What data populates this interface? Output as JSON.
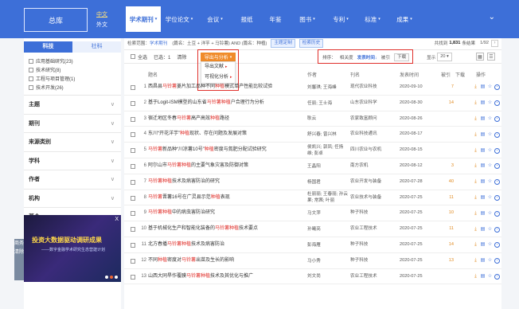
{
  "topnav": {
    "library_button": "总库",
    "lang_tabs": [
      "中文",
      "外文"
    ],
    "tabs": [
      {
        "label": "学术期刊",
        "dropdown": true
      },
      {
        "label": "学位论文",
        "dropdown": true
      },
      {
        "label": "会议",
        "dropdown": true
      },
      {
        "label": "报纸",
        "dropdown": false
      },
      {
        "label": "年鉴",
        "dropdown": false
      },
      {
        "label": "图书",
        "dropdown": true
      },
      {
        "label": "专利",
        "dropdown": true
      },
      {
        "label": "标准",
        "dropdown": true
      },
      {
        "label": "成果",
        "dropdown": true
      }
    ],
    "expand_icon": "chevron-down-icon",
    "brand_color": "#3d6fd8"
  },
  "sidebar": {
    "tabs": [
      "科技",
      "社科"
    ],
    "checklist": [
      "应用基础研究(23)",
      "技术研究(8)",
      "工程与项目管理(1)",
      "技术开发(26)"
    ],
    "sections": [
      "主题",
      "期刊",
      "来源类别",
      "学科",
      "作者",
      "机构",
      "基金"
    ],
    "ad": {
      "title": "投资大数据驱动调研成果",
      "subtitle": "——数字金融学术研究生态营建计划",
      "close": "X"
    },
    "side_edge": [
      "商务",
      "清除"
    ]
  },
  "breadcrumb": {
    "prefix": "检索范围：",
    "scope": "学术期刊",
    "query": "(篇名：土豆 + 洋芋 + 马铃薯) AND (篇名：种植)",
    "buttons": [
      "主题定制",
      "检索历史"
    ],
    "total_prefix": "共找到",
    "total": "1,831",
    "total_suffix": "条结果",
    "page": "1/92",
    "next_icon": "chevron-right-icon"
  },
  "toolbar": {
    "select_all": "全选",
    "selected": "已选：1",
    "clear": "清除",
    "export_button": "导出与分析",
    "export_menu": [
      "导出文献",
      "可视化分析"
    ],
    "sort_label": "排序：",
    "sort_options": [
      "相关度",
      "发表时间↓",
      "被引",
      "下载"
    ],
    "sort_active_index": 1,
    "show_label": "显示",
    "show_value": "20",
    "highlight_color": "#e0302b",
    "export_color": "#f08b2a"
  },
  "table": {
    "headers": {
      "title": "题名",
      "author": "作者",
      "source": "刊名",
      "date": "发表时间",
      "cite": "被引",
      "down": "下载",
      "ops": "操作"
    },
    "rows": [
      {
        "num": "1",
        "title": [
          {
            "t": "西昌县"
          },
          {
            "t": "马铃薯",
            "k": true
          },
          {
            "t": "菱片加工品种不同"
          },
          {
            "t": "种植",
            "k": true
          },
          {
            "t": "模式单产性能比较试验"
          }
        ],
        "author": "刘馨琪; 王海峰",
        "source": "现代农业科技",
        "date": "2020-09-10",
        "cite": "7",
        "down": ""
      },
      {
        "num": "2",
        "title": [
          {
            "t": "基于Logit-ISM模型的山东省"
          },
          {
            "t": "马铃薯",
            "k": true
          },
          {
            "t": "种植",
            "k": true
          },
          {
            "t": "户合理行为分析"
          }
        ],
        "author": "任丽; 王士海",
        "source": "山东农业科学",
        "date": "2020-08-30",
        "cite": "14",
        "down": ""
      },
      {
        "num": "3",
        "title": [
          {
            "t": "宿迁地区冬春"
          },
          {
            "t": "马铃薯",
            "k": true
          },
          {
            "t": "高产高效"
          },
          {
            "t": "种植",
            "k": true
          },
          {
            "t": "路径"
          }
        ],
        "author": "耿云",
        "source": "农家致富顾问",
        "date": "2020-08-26",
        "cite": "",
        "down": ""
      },
      {
        "num": "4",
        "title": [
          {
            "t": "东川“开花洋芋”"
          },
          {
            "t": "种植",
            "k": true
          },
          {
            "t": "现状、存在问题及发展对策"
          }
        ],
        "author": "舒兴春; 曾兴林",
        "source": "农业科技通讯",
        "date": "2020-08-17",
        "cite": "",
        "down": ""
      },
      {
        "num": "5",
        "title": [
          {
            "t": "马铃薯",
            "k": true
          },
          {
            "t": "新品种“川凉薯10号”"
          },
          {
            "t": "种植",
            "k": true
          },
          {
            "t": "密度与氮肥分配试验研究"
          }
        ],
        "author": "侯凯兴; 郭凤; 任扬维; 彭卓",
        "source": "四川农业与农机",
        "date": "2020-08-15",
        "cite": "",
        "down": ""
      },
      {
        "num": "6",
        "title": [
          {
            "t": "阿尔山市"
          },
          {
            "t": "马铃薯",
            "k": true
          },
          {
            "t": "种植",
            "k": true
          },
          {
            "t": "的主要气象灾害及防御对策"
          }
        ],
        "author": "王晶阳",
        "source": "南方农机",
        "date": "2020-08-12",
        "cite": "3",
        "down": ""
      },
      {
        "num": "7",
        "title": [
          {
            "t": "马铃薯",
            "k": true
          },
          {
            "t": "种植",
            "k": true
          },
          {
            "t": "技术及病害防治的研究"
          }
        ],
        "author": "杨国君",
        "source": "农业开发与装备",
        "date": "2020-07-28",
        "cite": "40",
        "down": ""
      },
      {
        "num": "8",
        "title": [
          {
            "t": "马铃薯",
            "k": true
          },
          {
            "t": "晋薯16号在广灵县示范"
          },
          {
            "t": "种植",
            "k": true
          },
          {
            "t": "表现"
          }
        ],
        "author": "杜丽丽; 王春丽; 孙云果; 常茜; 叶丽",
        "source": "农业技术与装备",
        "date": "2020-07-25",
        "cite": "11",
        "down": ""
      },
      {
        "num": "9",
        "title": [
          {
            "t": "马铃薯",
            "k": true
          },
          {
            "t": "种植",
            "k": true
          },
          {
            "t": "中的病虫害防治研究"
          }
        ],
        "author": "马文萍",
        "source": "种子科技",
        "date": "2020-07-25",
        "cite": "10",
        "down": ""
      },
      {
        "num": "10",
        "title": [
          {
            "t": "基于机械化生产和智能化装备的"
          },
          {
            "t": "马铃薯",
            "k": true
          },
          {
            "t": "种植",
            "k": true
          },
          {
            "t": "技术要点"
          }
        ],
        "author": "孙曦亮",
        "source": "农业工程技术",
        "date": "2020-07-25",
        "cite": "11",
        "down": ""
      },
      {
        "num": "11",
        "title": [
          {
            "t": "北方春播"
          },
          {
            "t": "马铃薯",
            "k": true
          },
          {
            "t": "种植",
            "k": true
          },
          {
            "t": "技术及病害防治"
          }
        ],
        "author": "彭海雁",
        "source": "种子科技",
        "date": "2020-07-25",
        "cite": "14",
        "down": ""
      },
      {
        "num": "12",
        "title": [
          {
            "t": "不同"
          },
          {
            "t": "种植",
            "k": true
          },
          {
            "t": "密度对"
          },
          {
            "t": "马铃薯",
            "k": true
          },
          {
            "t": "出苗及生长的影响"
          }
        ],
        "author": "马小秀",
        "source": "种子科技",
        "date": "2020-07-25",
        "cite": "13",
        "down": ""
      },
      {
        "num": "13",
        "title": [
          {
            "t": "山西大同旱作覆膜"
          },
          {
            "t": "马铃薯",
            "k": true
          },
          {
            "t": "种植",
            "k": true
          },
          {
            "t": "技术及其优化与推广"
          }
        ],
        "author": "刘文尚",
        "source": "农业工程技术",
        "date": "2020-07-25",
        "cite": "",
        "down": ""
      }
    ],
    "op_icons": [
      "download-icon",
      "read-icon",
      "star-icon",
      "quote-icon"
    ]
  }
}
